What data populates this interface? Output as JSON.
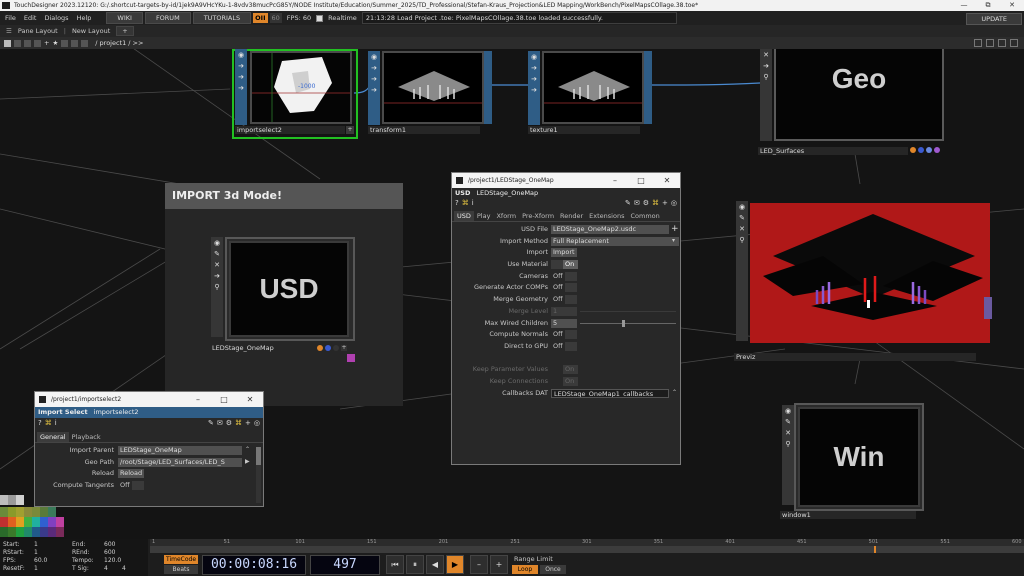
{
  "titlebar": {
    "text": "TouchDesigner 2023.12120: G:/.shortcut-targets-by-id/1jek9A9VHcYKu-1-8vdv38mucPcG85Y/NODE Institute/Education/Summer_2025/TD_Professional/Stefan-Kraus_Projection&LED Mapping/WorkBench/PixelMapsCOllage.38.toe*",
    "minimize": "—",
    "restore": "⧉",
    "close": "✕"
  },
  "menubar": {
    "items": [
      "File",
      "Edit",
      "Dialogs",
      "Help"
    ],
    "wiki": "WIKI",
    "forum": "FORUM",
    "tutorials": "TUTORIALS",
    "oii": "OII",
    "oii2": "60",
    "fps": "FPS:  60",
    "realtime": "Realtime",
    "status": "21:13:28 Load Project .toe: PixelMapsCOllage.38.toe loaded successfully.",
    "update": "UPDATE"
  },
  "panebar": {
    "pane_layout": "Pane Layout",
    "new_layout": "New Layout"
  },
  "pathbar": {
    "path": "/ project1 / >>"
  },
  "nodes": {
    "importselect": {
      "label": "importselect2",
      "readout": "-1000"
    },
    "transform": {
      "label": "transform1"
    },
    "texture": {
      "label": "texture1"
    },
    "geo": {
      "label": "LED_Surfaces",
      "title": "Geo"
    },
    "usd": {
      "label": "LEDStage_OneMap",
      "title": "USD"
    },
    "previz": {
      "label": "Previz"
    },
    "win": {
      "label": "window1",
      "title": "Win"
    }
  },
  "annotation": {
    "title": "IMPORT 3d Mode!"
  },
  "usd_dialog": {
    "window_title": "/project1/LEDStage_OneMap",
    "op_type": "USD",
    "op_name": "LEDStage_OneMap",
    "tabs": [
      "USD",
      "Play",
      "Xform",
      "Pre-Xform",
      "Render",
      "Extensions",
      "Common"
    ],
    "params": [
      {
        "label": "USD File",
        "value": "LEDStage_OneMap2.usdc"
      },
      {
        "label": "Import Method",
        "value": "Full Replacement"
      },
      {
        "label": "Import",
        "value": "Import"
      },
      {
        "label": "Use Material",
        "value": "On"
      },
      {
        "label": "Cameras",
        "value": "Off"
      },
      {
        "label": "Generate Actor COMPs",
        "value": "Off"
      },
      {
        "label": "Merge Geometry",
        "value": "Off"
      },
      {
        "label": "Merge Level",
        "value": "1"
      },
      {
        "label": "Max Wired Children",
        "value": "5"
      },
      {
        "label": "Compute Normals",
        "value": "Off"
      },
      {
        "label": "Direct to GPU",
        "value": "Off"
      },
      {
        "label": "",
        "value": ""
      },
      {
        "label": "Keep Parameter Values",
        "value": "On"
      },
      {
        "label": "Keep Connections",
        "value": "On"
      },
      {
        "label": "Callbacks DAT",
        "value": "LEDStage_OneMap1_callbacks"
      }
    ]
  },
  "import_dialog": {
    "window_title": "/project1/importselect2",
    "op_type": "Import Select",
    "op_name": "importselect2",
    "tabs": [
      "General",
      "Playback"
    ],
    "params": [
      {
        "label": "Import Parent",
        "value": "LEDStage_OneMap"
      },
      {
        "label": "Geo Path",
        "value": "/root/Stage/LED_Surfaces/LED_S"
      },
      {
        "label": "Reload",
        "value": "Reload"
      },
      {
        "label": "Compute Tangents",
        "value": "Off"
      }
    ]
  },
  "timeline_info": {
    "start_label": "Start:",
    "start": "1",
    "end_label": "End:",
    "end": "600",
    "rstart_label": "RStart:",
    "rstart": "1",
    "rend_label": "REnd:",
    "rend": "600",
    "fps_label": "FPS:",
    "fps": "60.0",
    "tempo_label": "Tempo:",
    "tempo": "120.0",
    "resetf_label": "ResetF:",
    "resetf": "1",
    "tsig_label": "T Sig:",
    "tsig1": "4",
    "tsig2": "4"
  },
  "ruler_ticks": [
    "1",
    "51",
    "101",
    "151",
    "201",
    "251",
    "301",
    "351",
    "401",
    "451",
    "501",
    "551",
    "600"
  ],
  "transport": {
    "timecode": "TimeCode",
    "beats": "Beats",
    "time": "00:00:08:16",
    "frame": "497",
    "range_limit": "Range Limit",
    "loop": "Loop",
    "once": "Once"
  },
  "playhead_fraction": 0.828,
  "colors": {
    "accent": "#e0862a",
    "selected": "#22c022",
    "render_red": "#b01818",
    "panel_blue": "#2f5d86"
  }
}
